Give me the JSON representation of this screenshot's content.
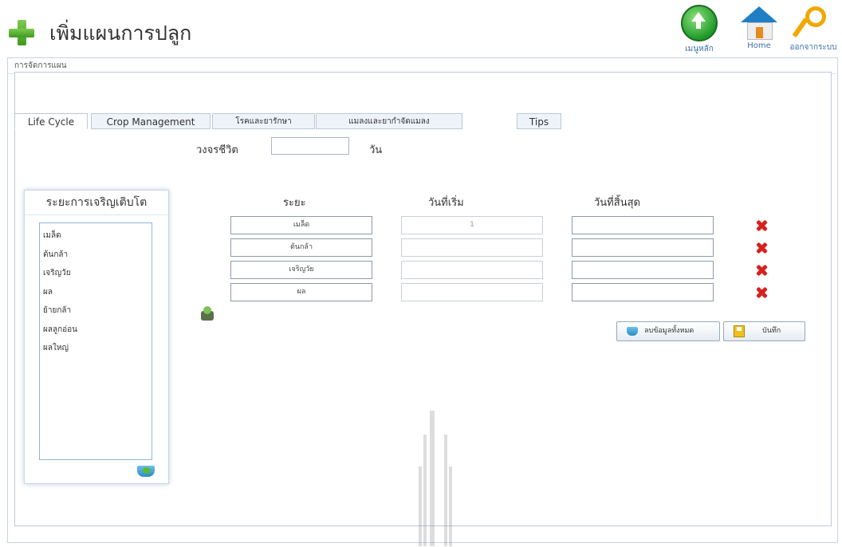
{
  "header": {
    "title": "เพิ่มแผนการปลูก",
    "buttons": [
      {
        "label": "เมนูหลัก",
        "icon": "up-arrow-icon"
      },
      {
        "label": "Home",
        "icon": "home-icon"
      },
      {
        "label": "ออกจากระบบ",
        "icon": "key-icon"
      }
    ]
  },
  "breadcrumb": "การจัดการแผน",
  "tabs": [
    {
      "label": "Life Cycle",
      "active": true
    },
    {
      "label": "Crop Management",
      "active": false
    },
    {
      "label": "โรคและยารักษา",
      "active": false
    },
    {
      "label": "แมลงและยากำจัดแมลง",
      "active": false
    },
    {
      "label": "Tips",
      "active": false
    }
  ],
  "life_cycle": {
    "label": "วงจรชีวิต",
    "value": "",
    "unit": "วัน"
  },
  "stage_panel": {
    "title": "ระยะการเจริญเติบโต",
    "items": [
      "เมล็ด",
      "ต้นกล้า",
      "เจริญวัย",
      "ผล",
      "ย้ายกล้า",
      "ผลลูกอ่อน",
      "ผลใหญ่"
    ]
  },
  "table": {
    "headers": {
      "stage": "ระยะ",
      "start": "วันที่เริ่ม",
      "end": "วันที่สิ้นสุด"
    },
    "rows": [
      {
        "stage": "เมล็ด",
        "start": "1",
        "end": ""
      },
      {
        "stage": "ต้นกล้า",
        "start": "",
        "end": ""
      },
      {
        "stage": "เจริญวัย",
        "start": "",
        "end": ""
      },
      {
        "stage": "ผล",
        "start": "",
        "end": ""
      }
    ]
  },
  "actions": {
    "load_all": "ลบข้อมูลทั้งหมด",
    "save": "บันทึก"
  }
}
